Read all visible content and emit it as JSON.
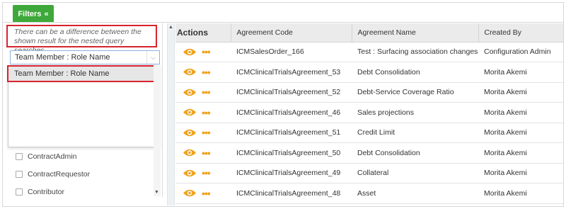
{
  "toolbar": {
    "filters_label": "Filters",
    "filters_icon": "double-chevron-left-icon"
  },
  "filter_panel": {
    "note": "There can be a difference between the shown result for the nested query searches.",
    "search": {
      "value": "Team Member : Role Name",
      "placeholder": ""
    },
    "dropdown": {
      "highlighted_option": "Team Member : Role Name"
    },
    "roles": [
      "ContractAdmin",
      "ContractRequestor",
      "Contributor"
    ]
  },
  "table": {
    "columns": [
      "Actions",
      "Agreement Code",
      "Agreement Name",
      "Created By"
    ],
    "rows": [
      {
        "code": "ICMSalesOrder_166",
        "name": "Test : Surfacing association changes",
        "created_by": "Configuration Admin"
      },
      {
        "code": "ICMClinicalTrialsAgreement_53",
        "name": "Debt Consolidation",
        "created_by": "Morita Akemi"
      },
      {
        "code": "ICMClinicalTrialsAgreement_52",
        "name": "Debt-Service Coverage Ratio",
        "created_by": "Morita Akemi"
      },
      {
        "code": "ICMClinicalTrialsAgreement_46",
        "name": "Sales projections",
        "created_by": "Morita Akemi"
      },
      {
        "code": "ICMClinicalTrialsAgreement_51",
        "name": "Credit Limit",
        "created_by": "Morita Akemi"
      },
      {
        "code": "ICMClinicalTrialsAgreement_50",
        "name": "Debt Consolidation",
        "created_by": "Morita Akemi"
      },
      {
        "code": "ICMClinicalTrialsAgreement_49",
        "name": "Collateral",
        "created_by": "Morita Akemi"
      },
      {
        "code": "ICMClinicalTrialsAgreement_48",
        "name": "Asset",
        "created_by": "Morita Akemi"
      }
    ],
    "action_icons": [
      "eye-icon",
      "more-actions-icon"
    ]
  },
  "colors": {
    "accent_green": "#3ea83a",
    "highlight_red": "#d9232d",
    "icon_orange": "#f0a21b"
  }
}
